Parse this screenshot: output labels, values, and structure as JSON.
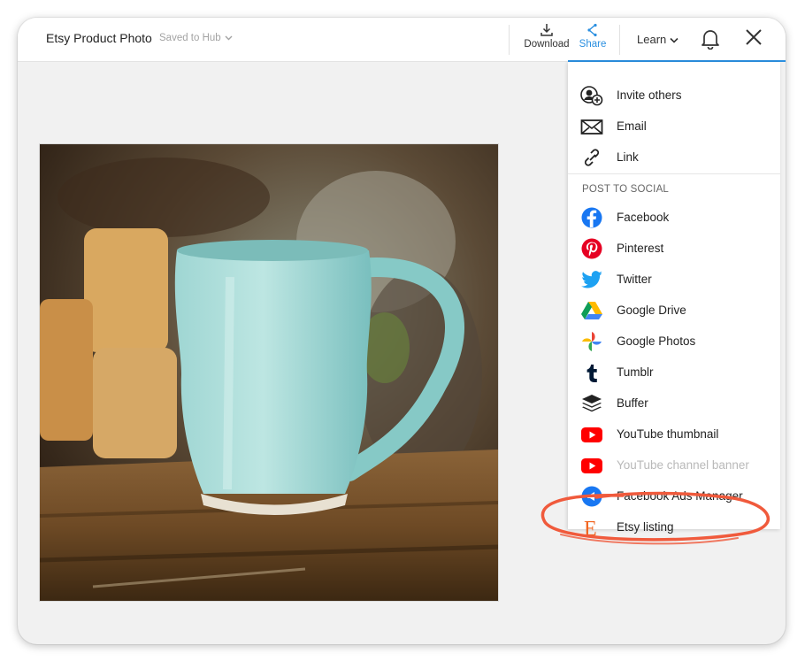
{
  "header": {
    "title": "Etsy Product Photo",
    "saved_label": "Saved to Hub",
    "download_label": "Download",
    "share_label": "Share",
    "learn_label": "Learn"
  },
  "icons": {
    "download": "download-icon",
    "share": "share-icon",
    "bell": "bell-icon",
    "close": "close-icon"
  },
  "share_menu": {
    "top_items": [
      {
        "label": "Invite others",
        "icon": "invite-user-icon"
      },
      {
        "label": "Email",
        "icon": "envelope-icon"
      },
      {
        "label": "Link",
        "icon": "link-icon"
      }
    ],
    "section_title": "POST TO SOCIAL",
    "social_items": [
      {
        "label": "Facebook",
        "icon": "facebook-icon",
        "color": "#1877f2"
      },
      {
        "label": "Pinterest",
        "icon": "pinterest-icon",
        "color": "#e60023"
      },
      {
        "label": "Twitter",
        "icon": "twitter-icon",
        "color": "#1da1f2"
      },
      {
        "label": "Google Drive",
        "icon": "google-drive-icon"
      },
      {
        "label": "Google Photos",
        "icon": "google-photos-icon"
      },
      {
        "label": "Tumblr",
        "icon": "tumblr-icon",
        "color": "#001935"
      },
      {
        "label": "Buffer",
        "icon": "buffer-icon",
        "color": "#222222"
      },
      {
        "label": "YouTube thumbnail",
        "icon": "youtube-icon",
        "color": "#ff0000"
      },
      {
        "label": "YouTube channel banner",
        "icon": "youtube-icon",
        "color": "#ff0000",
        "disabled": true
      },
      {
        "label": "Facebook Ads Manager",
        "icon": "facebook-ads-icon",
        "color": "#1877f2"
      },
      {
        "label": "Etsy listing",
        "icon": "etsy-icon",
        "color": "#f1641e"
      }
    ]
  },
  "colors": {
    "accent": "#2a8fe0",
    "highlight_circle": "#f05a3c"
  }
}
